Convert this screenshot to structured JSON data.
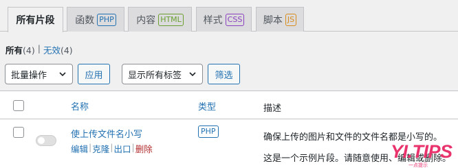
{
  "tabs": [
    {
      "label": "所有片段",
      "badge": "",
      "active": true
    },
    {
      "label": "函数",
      "badge": "PHP",
      "color": "#2271b1"
    },
    {
      "label": "内容",
      "badge": "HTML",
      "color": "#6a9f2f"
    },
    {
      "label": "样式",
      "badge": "CSS",
      "color": "#8a3fbf"
    },
    {
      "label": "脚本",
      "badge": "JS",
      "color": "#d98c1c"
    }
  ],
  "filters": {
    "all_label": "所有",
    "all_count": "(4)",
    "separator": "|",
    "inactive_label": "无效",
    "inactive_count": "(4)"
  },
  "bulk_select": {
    "value": "批量操作"
  },
  "apply_button": "应用",
  "tag_select": {
    "value": "显示所有标签"
  },
  "filter_button": "筛选",
  "table": {
    "headers": {
      "name": "名称",
      "type": "类型",
      "description": "描述"
    },
    "rows": [
      {
        "name": "使上传文件名小写",
        "actions": {
          "edit": "编辑",
          "clone": "克隆",
          "export": "出口",
          "delete": "删除"
        },
        "type": "PHP",
        "description_line1": "确保上传的图片和文件的文件名都是小写的。",
        "description_line2": "这是一个示例片段。请随意使用、编辑或删除。"
      }
    ]
  },
  "watermark": {
    "main": "YI.TIPS",
    "sub": "一点提示"
  }
}
